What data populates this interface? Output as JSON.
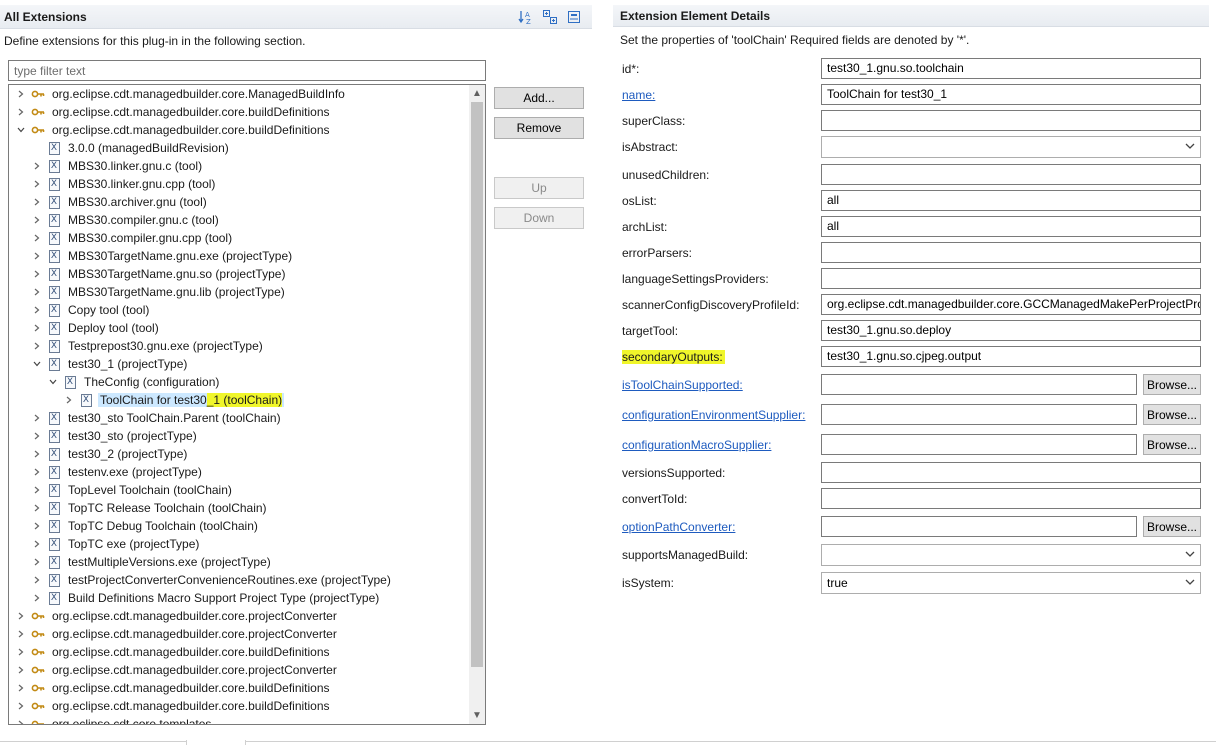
{
  "left": {
    "title": "All Extensions",
    "description": "Define extensions for this plug-in in the following section.",
    "filter_placeholder": "type filter text",
    "buttons": {
      "add": "Add...",
      "remove": "Remove",
      "up": "Up",
      "down": "Down"
    },
    "tree": [
      {
        "indent": 0,
        "chev": ">",
        "icon": "ext",
        "label": "org.eclipse.cdt.managedbuilder.core.ManagedBuildInfo"
      },
      {
        "indent": 0,
        "chev": ">",
        "icon": "ext",
        "label": "org.eclipse.cdt.managedbuilder.core.buildDefinitions"
      },
      {
        "indent": 0,
        "chev": "v",
        "icon": "ext",
        "label": "org.eclipse.cdt.managedbuilder.core.buildDefinitions"
      },
      {
        "indent": 1,
        "chev": "",
        "icon": "el",
        "label": "3.0.0 (managedBuildRevision)"
      },
      {
        "indent": 1,
        "chev": ">",
        "icon": "el",
        "label": "MBS30.linker.gnu.c (tool)"
      },
      {
        "indent": 1,
        "chev": ">",
        "icon": "el",
        "label": "MBS30.linker.gnu.cpp (tool)"
      },
      {
        "indent": 1,
        "chev": ">",
        "icon": "el",
        "label": "MBS30.archiver.gnu (tool)"
      },
      {
        "indent": 1,
        "chev": ">",
        "icon": "el",
        "label": "MBS30.compiler.gnu.c (tool)"
      },
      {
        "indent": 1,
        "chev": ">",
        "icon": "el",
        "label": "MBS30.compiler.gnu.cpp (tool)"
      },
      {
        "indent": 1,
        "chev": ">",
        "icon": "el",
        "label": "MBS30TargetName.gnu.exe (projectType)"
      },
      {
        "indent": 1,
        "chev": ">",
        "icon": "el",
        "label": "MBS30TargetName.gnu.so (projectType)"
      },
      {
        "indent": 1,
        "chev": ">",
        "icon": "el",
        "label": "MBS30TargetName.gnu.lib (projectType)"
      },
      {
        "indent": 1,
        "chev": ">",
        "icon": "el",
        "label": "Copy tool (tool)"
      },
      {
        "indent": 1,
        "chev": ">",
        "icon": "el",
        "label": "Deploy tool (tool)"
      },
      {
        "indent": 1,
        "chev": ">",
        "icon": "el",
        "label": "Testprepost30.gnu.exe (projectType)"
      },
      {
        "indent": 1,
        "chev": "v",
        "icon": "el",
        "label": "test30_1 (projectType)"
      },
      {
        "indent": 2,
        "chev": "v",
        "icon": "el",
        "label": "TheConfig (configuration)"
      },
      {
        "indent": 3,
        "chev": ">",
        "icon": "el",
        "label": "ToolChain for test30_1 (toolChain)",
        "selected": true,
        "hl_before": "ToolChain for test30",
        "hl_text": "_1 (toolChain)"
      },
      {
        "indent": 1,
        "chev": ">",
        "icon": "el",
        "label": "test30_sto ToolChain.Parent (toolChain)"
      },
      {
        "indent": 1,
        "chev": ">",
        "icon": "el",
        "label": "test30_sto (projectType)"
      },
      {
        "indent": 1,
        "chev": ">",
        "icon": "el",
        "label": "test30_2 (projectType)"
      },
      {
        "indent": 1,
        "chev": ">",
        "icon": "el",
        "label": "testenv.exe (projectType)"
      },
      {
        "indent": 1,
        "chev": ">",
        "icon": "el",
        "label": "TopLevel Toolchain (toolChain)"
      },
      {
        "indent": 1,
        "chev": ">",
        "icon": "el",
        "label": "TopTC Release Toolchain (toolChain)"
      },
      {
        "indent": 1,
        "chev": ">",
        "icon": "el",
        "label": "TopTC Debug Toolchain (toolChain)"
      },
      {
        "indent": 1,
        "chev": ">",
        "icon": "el",
        "label": "TopTC exe (projectType)"
      },
      {
        "indent": 1,
        "chev": ">",
        "icon": "el",
        "label": "testMultipleVersions.exe (projectType)"
      },
      {
        "indent": 1,
        "chev": ">",
        "icon": "el",
        "label": "testProjectConverterConvenienceRoutines.exe (projectType)"
      },
      {
        "indent": 1,
        "chev": ">",
        "icon": "el",
        "label": "Build Definitions Macro Support Project Type (projectType)"
      },
      {
        "indent": 0,
        "chev": ">",
        "icon": "ext",
        "label": "org.eclipse.cdt.managedbuilder.core.projectConverter"
      },
      {
        "indent": 0,
        "chev": ">",
        "icon": "ext",
        "label": "org.eclipse.cdt.managedbuilder.core.projectConverter"
      },
      {
        "indent": 0,
        "chev": ">",
        "icon": "ext",
        "label": "org.eclipse.cdt.managedbuilder.core.buildDefinitions"
      },
      {
        "indent": 0,
        "chev": ">",
        "icon": "ext",
        "label": "org.eclipse.cdt.managedbuilder.core.projectConverter"
      },
      {
        "indent": 0,
        "chev": ">",
        "icon": "ext",
        "label": "org.eclipse.cdt.managedbuilder.core.buildDefinitions"
      },
      {
        "indent": 0,
        "chev": ">",
        "icon": "ext",
        "label": "org.eclipse.cdt.managedbuilder.core.buildDefinitions"
      },
      {
        "indent": 0,
        "chev": ">",
        "icon": "ext",
        "label": "org.eclipse.cdt.core.templates"
      }
    ]
  },
  "right": {
    "title": "Extension Element Details",
    "description": "Set the properties of 'toolChain' Required fields are denoted by '*'.",
    "browse_label": "Browse...",
    "fields": [
      {
        "label": "id*:",
        "type": "text",
        "value": "test30_1.gnu.so.toolchain"
      },
      {
        "label": "name:",
        "type": "text",
        "value": "ToolChain for test30_1",
        "link": true
      },
      {
        "label": "superClass:",
        "type": "text",
        "value": ""
      },
      {
        "label": "isAbstract:",
        "type": "select",
        "value": ""
      },
      {
        "label": "unusedChildren:",
        "type": "text",
        "value": ""
      },
      {
        "label": "osList:",
        "type": "text",
        "value": "all"
      },
      {
        "label": "archList:",
        "type": "text",
        "value": "all"
      },
      {
        "label": "errorParsers:",
        "type": "text",
        "value": ""
      },
      {
        "label": "languageSettingsProviders:",
        "type": "text",
        "value": ""
      },
      {
        "label": "scannerConfigDiscoveryProfileId:",
        "type": "text",
        "value": "org.eclipse.cdt.managedbuilder.core.GCCManagedMakePerProjectPro"
      },
      {
        "label": "targetTool:",
        "type": "text",
        "value": "test30_1.gnu.so.deploy"
      },
      {
        "label": "secondaryOutputs:",
        "type": "text",
        "value": "test30_1.gnu.so.cjpeg.output",
        "marked": true
      },
      {
        "label": "isToolChainSupported:",
        "type": "browse",
        "value": "",
        "link": true
      },
      {
        "label": "configurationEnvironmentSupplier:",
        "type": "browse",
        "value": "",
        "link": true
      },
      {
        "label": "configurationMacroSupplier:",
        "type": "browse",
        "value": "",
        "link": true
      },
      {
        "label": "versionsSupported:",
        "type": "text",
        "value": ""
      },
      {
        "label": "convertToId:",
        "type": "text",
        "value": ""
      },
      {
        "label": "optionPathConverter:",
        "type": "browse",
        "value": "",
        "link": true
      },
      {
        "label": "supportsManagedBuild:",
        "type": "select",
        "value": ""
      },
      {
        "label": "isSystem:",
        "type": "select",
        "value": "true"
      }
    ]
  }
}
